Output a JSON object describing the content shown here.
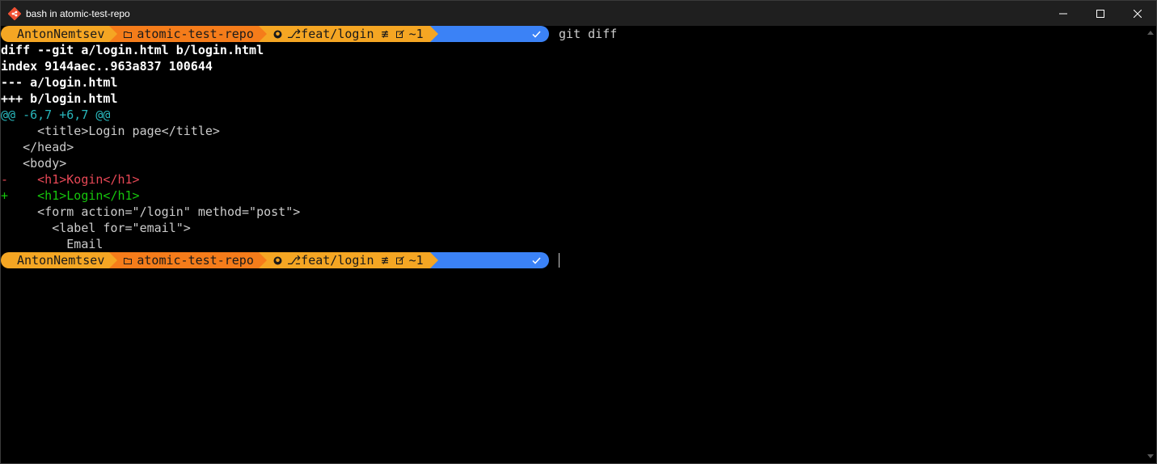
{
  "window": {
    "title": "bash in atomic-test-repo",
    "icon": "git-bash-icon"
  },
  "prompt": {
    "user": "AntonNemtsev",
    "folder_icon": "folder-icon",
    "repo": "atomic-test-repo",
    "github_icon": "github-icon",
    "branch_icon": "branch-icon",
    "branch": "feat/login",
    "status_sep": "≢",
    "changes_icon": "edit-icon",
    "changes": "~1",
    "ok_icon": "check-icon",
    "colors": {
      "user": "#f5a623",
      "path": "#f57c1a",
      "git": "#f5a623",
      "ok": "#3b82f6"
    }
  },
  "command": "git diff",
  "diff": {
    "header1": "diff --git a/login.html b/login.html",
    "header2": "index 9144aec..963a837 100644",
    "header3": "--- a/login.html",
    "header4": "+++ b/login.html",
    "hunk": "@@ -6,7 +6,7 @@",
    "lines": [
      {
        "prefix": " ",
        "text": "    <title>Login page</title>",
        "kind": "context"
      },
      {
        "prefix": " ",
        "text": "  </head>",
        "kind": "context"
      },
      {
        "prefix": " ",
        "text": "  <body>",
        "kind": "context"
      },
      {
        "prefix": "-",
        "text": "    <h1>Kogin</h1>",
        "kind": "removed"
      },
      {
        "prefix": "+",
        "text": "    <h1>Login</h1>",
        "kind": "added"
      },
      {
        "prefix": " ",
        "text": "    <form action=\"/login\" method=\"post\">",
        "kind": "context"
      },
      {
        "prefix": " ",
        "text": "      <label for=\"email\">",
        "kind": "context"
      },
      {
        "prefix": " ",
        "text": "        Email",
        "kind": "context"
      }
    ]
  }
}
